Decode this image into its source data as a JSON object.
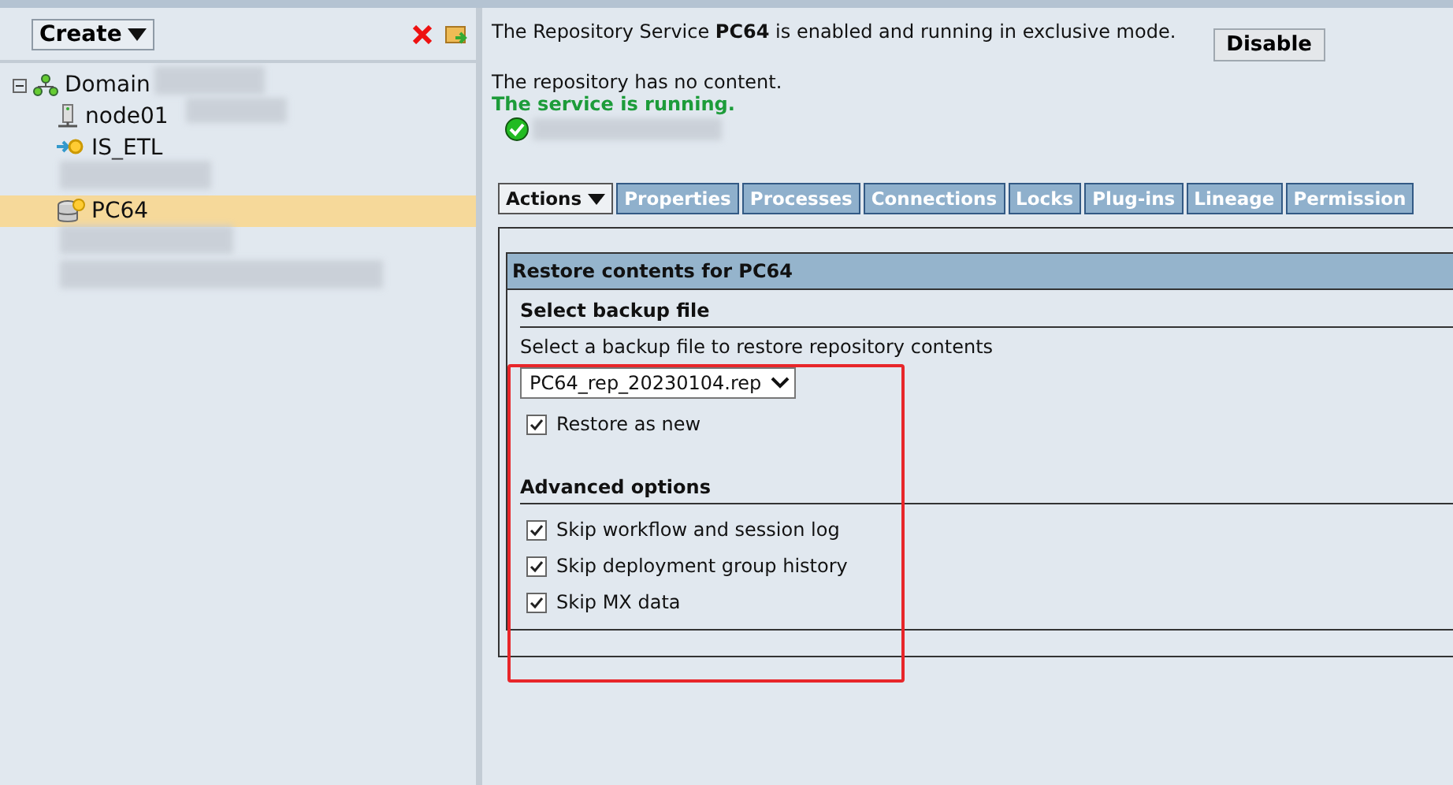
{
  "sidebar": {
    "create_button": "Create",
    "tree": [
      {
        "label": "Domain",
        "kind": "domain",
        "expanded": true,
        "selected": false,
        "children": [
          {
            "label": "node01",
            "kind": "node",
            "selected": false
          },
          {
            "label": "IS_ETL",
            "kind": "service",
            "selected": false
          },
          {
            "label": "PC64",
            "kind": "repository",
            "selected": true
          }
        ]
      }
    ]
  },
  "status": {
    "message": "The Repository Service **PC64** is enabled and running in exclusive mode.",
    "disable_button": "Disable",
    "content_note": "The repository has no content.",
    "running_note": "The service is running."
  },
  "tabs": [
    {
      "label": "Actions",
      "selected": true,
      "dropdown": true
    },
    {
      "label": "Properties",
      "selected": false,
      "dropdown": false
    },
    {
      "label": "Processes",
      "selected": false,
      "dropdown": false
    },
    {
      "label": "Connections",
      "selected": false,
      "dropdown": false
    },
    {
      "label": "Locks",
      "selected": false,
      "dropdown": false
    },
    {
      "label": "Plug-ins",
      "selected": false,
      "dropdown": false
    },
    {
      "label": "Lineage",
      "selected": false,
      "dropdown": false
    },
    {
      "label": "Permission",
      "selected": false,
      "dropdown": false
    }
  ],
  "restore_panel": {
    "title": "Restore contents for PC64",
    "backup_section": {
      "heading": "Select backup file",
      "hint": "Select a backup file to restore repository contents",
      "file_select": "PC64_rep_20230104.rep",
      "options": [
        {
          "label": "Restore as new",
          "checked": true
        }
      ]
    },
    "advanced_section": {
      "heading": "Advanced options",
      "options": [
        {
          "label": "Skip workflow and session log",
          "checked": true
        },
        {
          "label": "Skip deployment group history",
          "checked": true
        },
        {
          "label": "Skip MX data",
          "checked": true
        }
      ]
    }
  }
}
